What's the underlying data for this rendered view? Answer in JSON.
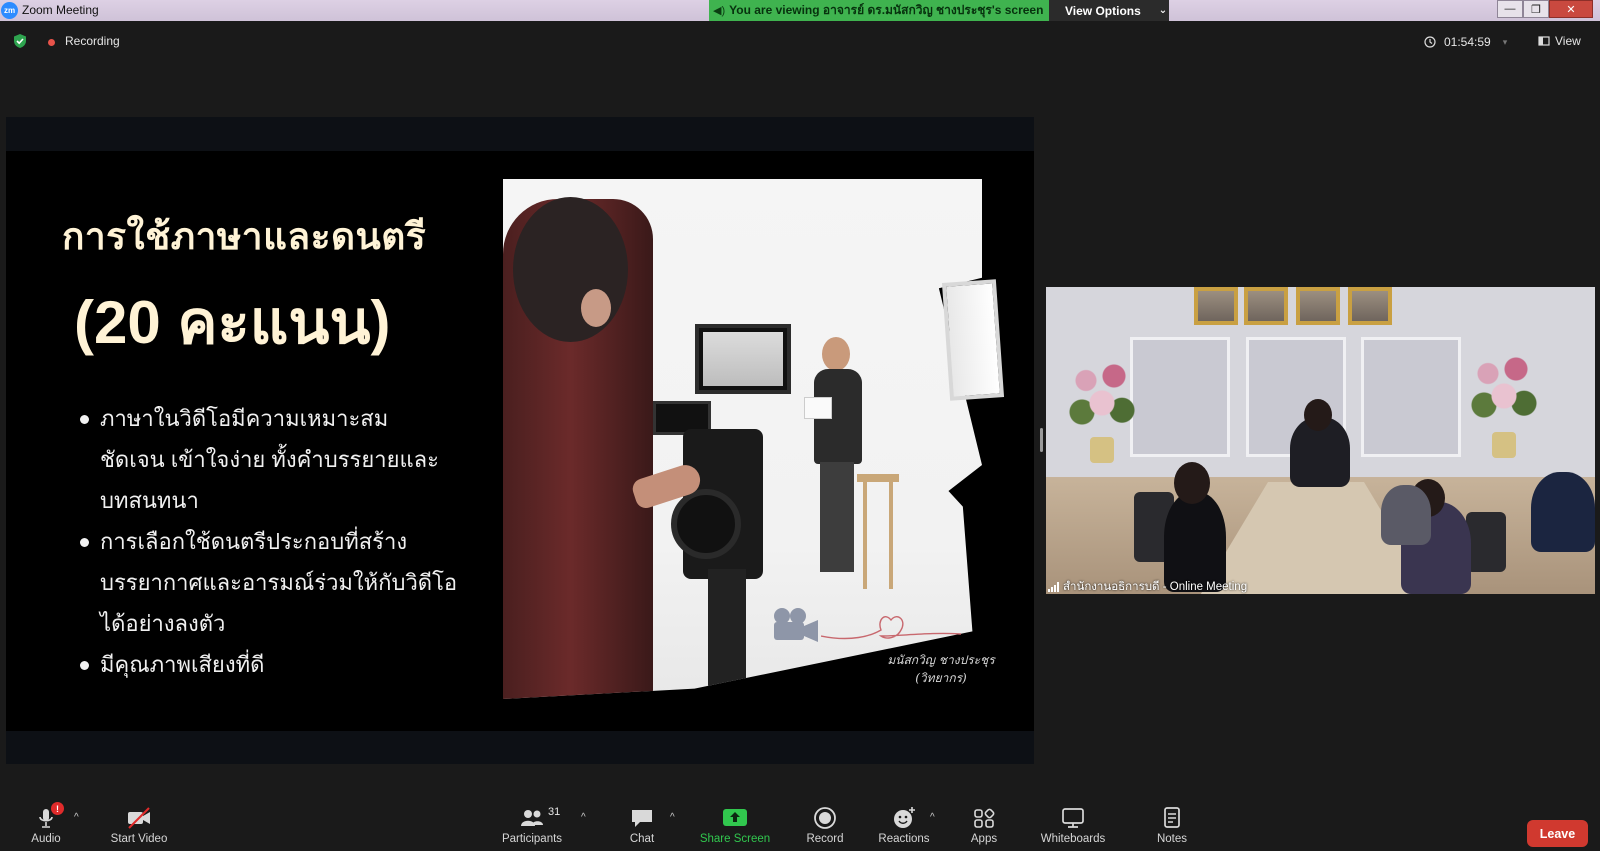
{
  "window": {
    "app_title": "Zoom Meeting",
    "logo_text": "zm",
    "viewing_banner": "You are viewing อาจารย์ ดร.มนัสกวิญ ชางประชุร's screen",
    "view_options": "View Options",
    "controls": {
      "minimize": "—",
      "restore": "❐",
      "close": "✕"
    }
  },
  "status_bar": {
    "recording_label": "Recording",
    "elapsed_time": "01:54:59",
    "view_label": "View"
  },
  "slide": {
    "title": "การใช้ภาษาและดนตรี",
    "subtitle": "(20 คะแนน)",
    "bullets": [
      "ภาษาในวิดีโอมีความเหมาะสม ชัดเจน เข้าใจง่าย ทั้งคำบรรยายและบทสนทนา",
      "การเลือกใช้ดนตรีประกอบที่สร้างบรรยากาศและอารมณ์ร่วมให้กับวิดีโอได้อย่างลงตัว",
      "มีคุณภาพเสียงที่ดี"
    ],
    "credit_name": "มนัสกวิญ ชางประชุร",
    "credit_role": "(วิทยากร)"
  },
  "participant_video": {
    "name_label": "สำนักงานอธิการบดี - Online Meeting"
  },
  "toolbar": {
    "audio": {
      "label": "Audio",
      "badge": "!"
    },
    "start_video": {
      "label": "Start Video"
    },
    "participants": {
      "label": "Participants",
      "count": "31"
    },
    "chat": {
      "label": "Chat"
    },
    "share_screen": {
      "label": "Share Screen",
      "color": "#31c74e"
    },
    "record": {
      "label": "Record"
    },
    "reactions": {
      "label": "Reactions"
    },
    "apps": {
      "label": "Apps"
    },
    "whiteboards": {
      "label": "Whiteboards"
    },
    "notes": {
      "label": "Notes"
    },
    "leave": {
      "label": "Leave",
      "color": "#d0392f"
    },
    "caret": "^"
  },
  "colors": {
    "banner_green": "#3fb34f",
    "recording_red": "#e8534a",
    "slide_title_cream": "#fff3d6"
  }
}
